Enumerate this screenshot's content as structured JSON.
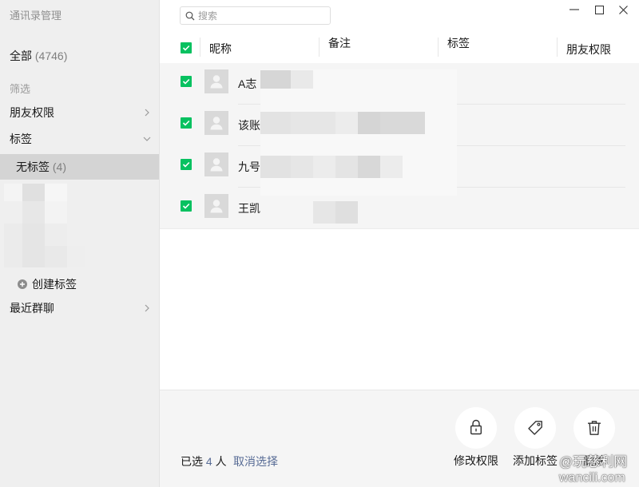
{
  "window": {
    "title": "通讯录管理",
    "controls": [
      "minimize-icon",
      "maximize-icon",
      "close-icon"
    ]
  },
  "sidebar": {
    "all": {
      "label": "全部",
      "count": "(4746)"
    },
    "filter_heading": "筛选",
    "friend_permissions": {
      "label": "朋友权限",
      "icon": "chevron-right-icon"
    },
    "tags_group": {
      "label": "标签",
      "icon": "chevron-down-icon",
      "expanded": true
    },
    "tags": [
      {
        "label": "无标签",
        "count": "(4)",
        "selected": true
      }
    ],
    "create_tag": {
      "label": "创建标签",
      "icon": "plus-circle-icon"
    },
    "recent_groups": {
      "label": "最近群聊",
      "icon": "chevron-right-icon"
    }
  },
  "search": {
    "placeholder": "搜索",
    "value": "",
    "icon": "search-icon"
  },
  "table": {
    "select_all_checked": true,
    "columns": [
      "昵称",
      "备注",
      "标签",
      "朋友权限"
    ],
    "rows": [
      {
        "name": "A志",
        "checked": true,
        "avatar": "default-avatar-icon"
      },
      {
        "name": "该账",
        "checked": true,
        "avatar": "default-avatar-icon"
      },
      {
        "name": "九号",
        "checked": true,
        "avatar": "default-avatar-icon"
      },
      {
        "name": "王凯",
        "checked": true,
        "avatar": "default-avatar-icon"
      }
    ]
  },
  "footer": {
    "selected_prefix": "已选",
    "selected_count": "4",
    "selected_suffix": "人",
    "clear_selection": "取消选择",
    "actions": [
      {
        "label": "修改权限",
        "icon": "lock-icon"
      },
      {
        "label": "添加标签",
        "icon": "tag-icon"
      },
      {
        "label": "删除",
        "icon": "trash-icon"
      }
    ]
  },
  "watermark": {
    "line1": "@玩慈利网",
    "line2": "wancili.com"
  },
  "colors": {
    "accent": "#07c160",
    "link": "#576b95"
  }
}
